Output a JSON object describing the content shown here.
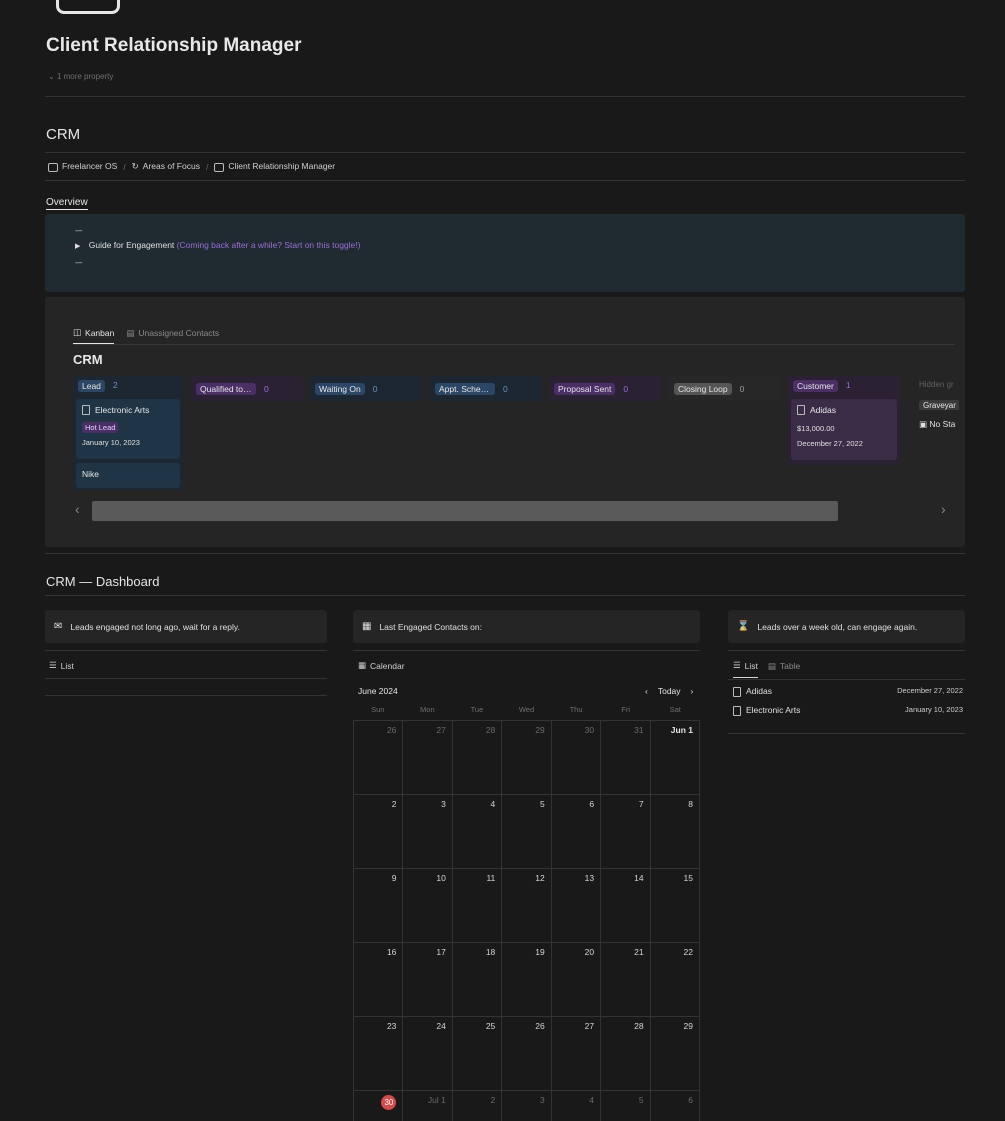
{
  "page": {
    "title": "Client Relationship Manager",
    "more_property": "1 more property"
  },
  "crm": {
    "heading": "CRM",
    "breadcrumb": [
      "Freelancer OS",
      "Areas of Focus",
      "Client Relationship Manager"
    ],
    "overview_tab": "Overview",
    "callout": {
      "divider": "----",
      "toggle_label": "Guide for Engagement",
      "toggle_hint": "(Coming back after a while? Start on this toggle!)"
    }
  },
  "board": {
    "tabs": [
      "Kanban",
      "Unassigned Contacts"
    ],
    "title": "CRM",
    "columns": [
      {
        "label": "Lead",
        "count": "2",
        "color": "#2c4766"
      },
      {
        "label": "Qualified to ...",
        "count": "0",
        "color": "#4a2f66"
      },
      {
        "label": "Waiting On",
        "count": "0",
        "color": "#2c4766"
      },
      {
        "label": "Appt. Sched...",
        "count": "0",
        "color": "#2c4766"
      },
      {
        "label": "Proposal Sent",
        "count": "0",
        "color": "#4a2f66"
      },
      {
        "label": "Closing Loop",
        "count": "0",
        "color": "#555555"
      },
      {
        "label": "Customer",
        "count": "1",
        "color": "#4a2f66"
      }
    ],
    "hidden_groups_label": "Hidden gr",
    "hidden_items": [
      "Graveyar",
      "No Sta"
    ],
    "cards": {
      "electronic_arts": {
        "name": "Electronic Arts",
        "tag": "Hot Lead",
        "date": "January 10, 2023"
      },
      "nike": {
        "name": "Nike"
      },
      "adidas": {
        "name": "Adidas",
        "value": "$13,000.00",
        "date": "December 27, 2022"
      }
    }
  },
  "dashboard": {
    "title": "CRM — Dashboard",
    "cards": [
      {
        "text": "Leads engaged not long ago, wait for a reply.",
        "icon": "mail-icon"
      },
      {
        "text": "Last Engaged Contacts on:",
        "icon": "calendar-icon"
      },
      {
        "text": "Leads over a week old, can engage again.",
        "icon": "hourglass-icon"
      }
    ],
    "left_tab": "List",
    "middle_tab": "Calendar",
    "right_tabs": [
      "List",
      "Table"
    ],
    "calendar": {
      "month": "June 2024",
      "today_label": "Today",
      "weekdays": [
        "Sun",
        "Mon",
        "Tue",
        "Wed",
        "Thu",
        "Fri",
        "Sat"
      ],
      "weeks": [
        [
          "26",
          "27",
          "28",
          "29",
          "30",
          "31",
          "Jun 1"
        ],
        [
          "2",
          "3",
          "4",
          "5",
          "6",
          "7",
          "8"
        ],
        [
          "9",
          "10",
          "11",
          "12",
          "13",
          "14",
          "15"
        ],
        [
          "16",
          "17",
          "18",
          "19",
          "20",
          "21",
          "22"
        ],
        [
          "23",
          "24",
          "25",
          "26",
          "27",
          "28",
          "29"
        ],
        [
          "30",
          "Jul 1",
          "2",
          "3",
          "4",
          "5",
          "6"
        ]
      ]
    },
    "right_list": [
      {
        "name": "Adidas",
        "date": "December 27, 2022"
      },
      {
        "name": "Electronic Arts",
        "date": "January 10, 2023"
      }
    ]
  }
}
